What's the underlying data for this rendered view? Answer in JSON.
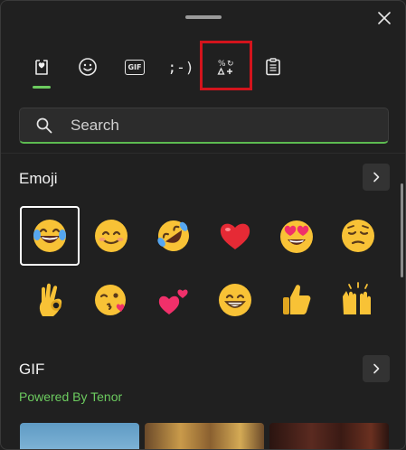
{
  "search": {
    "placeholder": "Search"
  },
  "tabs": [
    {
      "name": "Recently used"
    },
    {
      "name": "Emoji"
    },
    {
      "name": "GIF"
    },
    {
      "name": "Kaomoji"
    },
    {
      "name": "Symbols"
    },
    {
      "name": "Clipboard history"
    }
  ],
  "tab_icons": {
    "kaomoji": ";-)",
    "gif": "GIF"
  },
  "sections": {
    "emoji": {
      "title": "Emoji"
    },
    "gif": {
      "title": "GIF",
      "powered_by": "Powered By Tenor"
    }
  },
  "emojis": [
    {
      "name": "face-with-tears-of-joy"
    },
    {
      "name": "smiling-face-with-smiling-eyes"
    },
    {
      "name": "rolling-on-the-floor-laughing"
    },
    {
      "name": "red-heart"
    },
    {
      "name": "smiling-face-with-heart-eyes"
    },
    {
      "name": "pensive-face"
    },
    {
      "name": "ok-hand"
    },
    {
      "name": "face-blowing-a-kiss"
    },
    {
      "name": "two-hearts"
    },
    {
      "name": "beaming-face-with-smiling-eyes"
    },
    {
      "name": "thumbs-up"
    },
    {
      "name": "raising-hands"
    }
  ],
  "colors": {
    "accent": "#6ccb5f",
    "highlight": "#d3141c",
    "background": "#202020"
  }
}
